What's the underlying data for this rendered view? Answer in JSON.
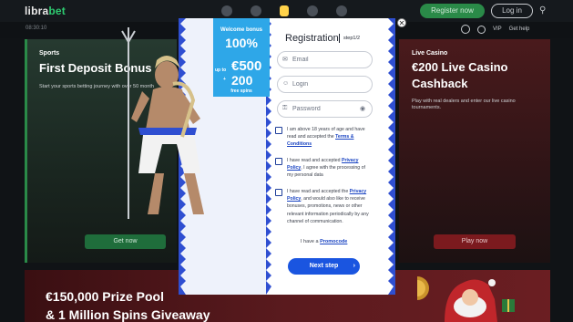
{
  "header": {
    "logo_left": "libra",
    "logo_right": "bet",
    "register_label": "Register now",
    "login_label": "Log in",
    "search_icon": "search-icon",
    "nav_icons": [
      "football-icon",
      "soccer-ball-icon",
      "slot-icon",
      "rabbit-icon",
      "chat-icon"
    ]
  },
  "subbar": {
    "clock": "08:30:10",
    "vip_label": "VIP",
    "help_label": "Get help"
  },
  "promo_left": {
    "label": "Sports",
    "title": "First Deposit Bonus",
    "desc": "Start your sports betting journey with over 50 month",
    "button": "Get now"
  },
  "promo_right": {
    "label": "Live Casino",
    "title_1": "€200 Live Casino",
    "title_2": "Cashback",
    "desc": "Play with real dealers and enter our live casino tournaments.",
    "button": "Play now"
  },
  "banner": {
    "line1": "€150,000 Prize Pool",
    "line2": "& 1 Million Spins Giveaway"
  },
  "bonus": {
    "line1": "Welcome bonus",
    "line2": "100%",
    "line3": "up to",
    "line4": "€500",
    "line5": "+",
    "line6": "200",
    "line7": "free spins"
  },
  "registration": {
    "title": "Registration",
    "step": "step1/2",
    "email_placeholder": "Email",
    "login_placeholder": "Login",
    "password_placeholder": "Password",
    "check1_text": "I am above 18 years of age and have read and accepted the ",
    "check1_link": "Terms & Conditions",
    "check2_pre": "I have read and accepted ",
    "check2_link": "Privacy Policy",
    "check2_post": ", I agree with the processing of my personal data",
    "check3_pre": "I have read and accepted the ",
    "check3_link": "Privacy Policy",
    "check3_post": ", and would also like to receive bonuses, promotions, news or other relevant information periodically by any channel of communication.",
    "promo_pre": "I have a ",
    "promo_link": "Promocode",
    "next_label": "Next step"
  },
  "colors": {
    "accent_blue": "#1a55e0",
    "bonus_blue": "#2ea7e8",
    "register_green": "#2a8a48"
  }
}
